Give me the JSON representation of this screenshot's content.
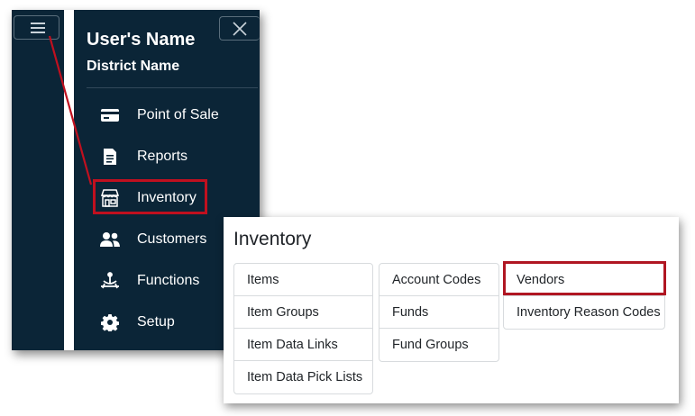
{
  "sidebar": {
    "user_name": "User's Name",
    "district_name": "District Name",
    "items": [
      {
        "label": "Point of Sale",
        "icon": "credit-card-icon"
      },
      {
        "label": "Reports",
        "icon": "report-document-icon"
      },
      {
        "label": "Inventory",
        "icon": "storefront-icon"
      },
      {
        "label": "Customers",
        "icon": "users-icon"
      },
      {
        "label": "Functions",
        "icon": "functions-icon"
      },
      {
        "label": "Setup",
        "icon": "gear-icon"
      }
    ],
    "highlighted_item": "Inventory"
  },
  "inventory": {
    "title": "Inventory",
    "columns": [
      [
        "Items",
        "Item Groups",
        "Item Data Links",
        "Item Data Pick Lists"
      ],
      [
        "Account Codes",
        "Funds",
        "Fund Groups"
      ],
      [
        "Vendors",
        "Inventory Reason Codes"
      ]
    ],
    "highlighted_item": "Vendors"
  },
  "colors": {
    "sidebar_bg": "#0b2537",
    "highlight": "#c0101f"
  }
}
